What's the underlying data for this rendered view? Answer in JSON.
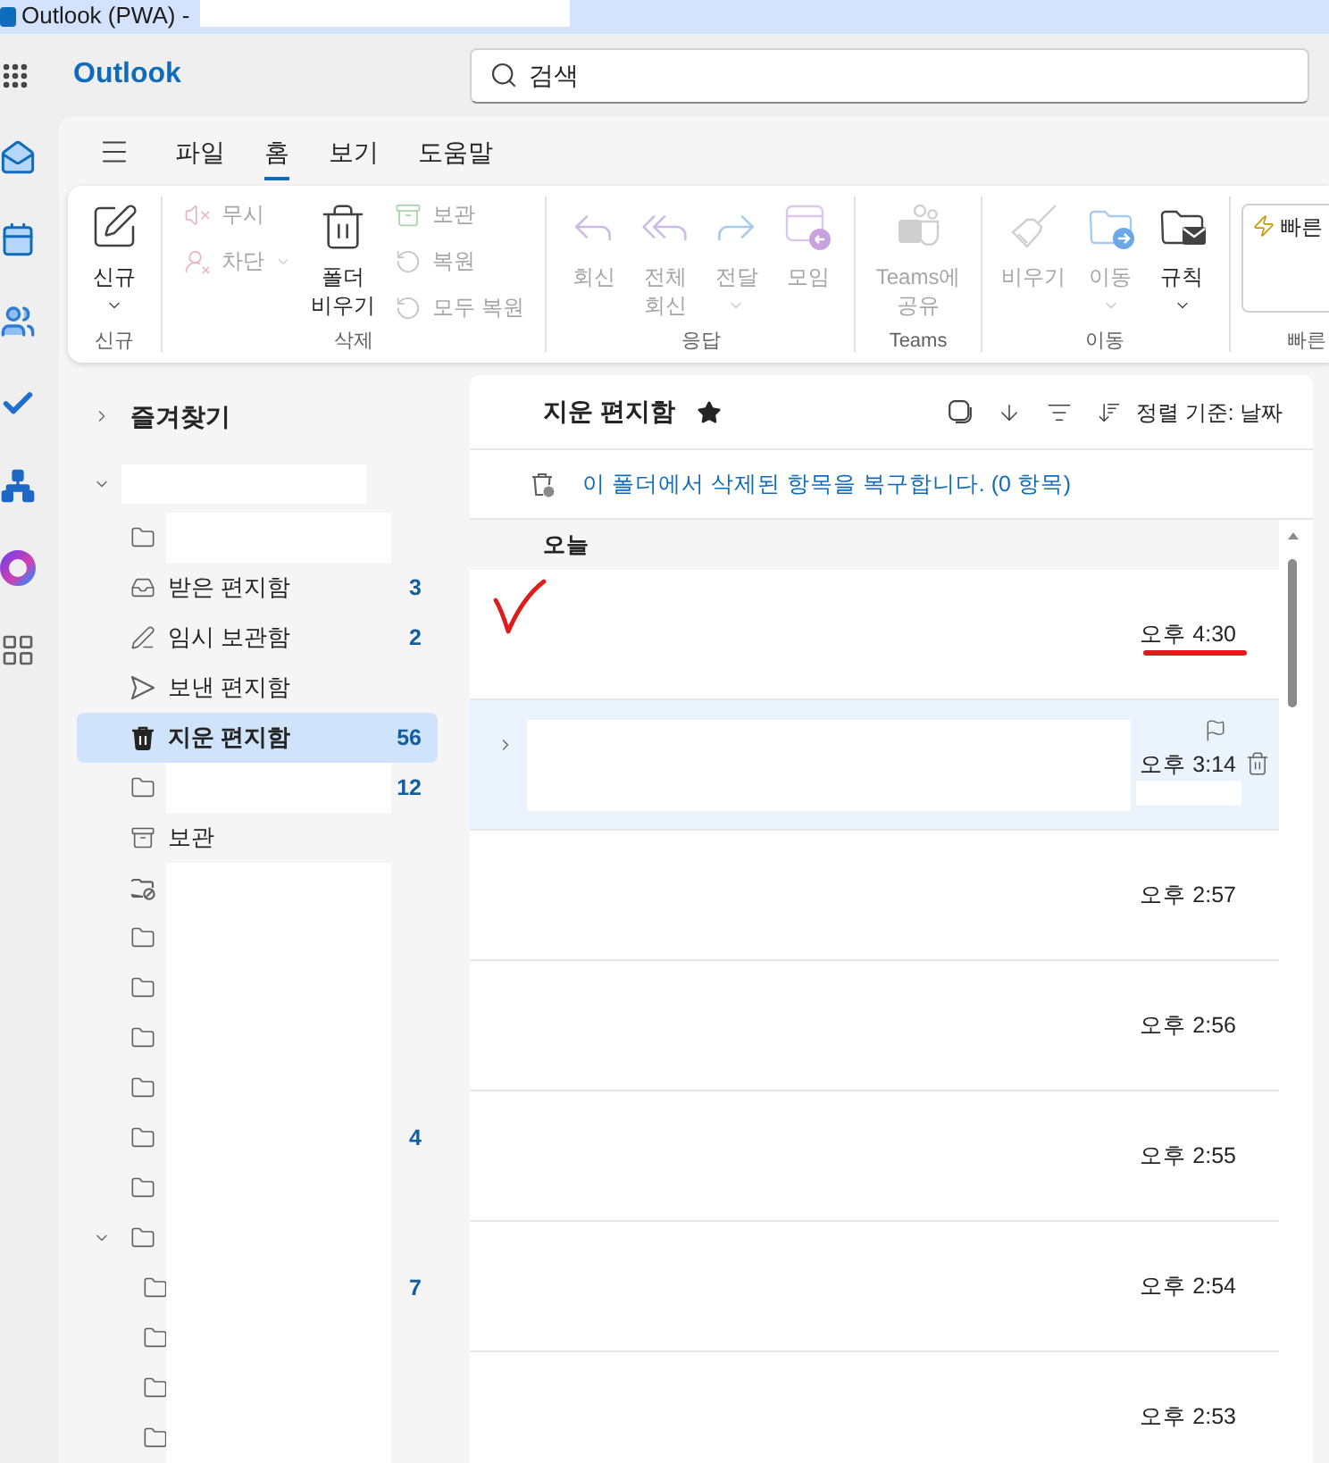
{
  "window": {
    "title": "Outlook (PWA) -"
  },
  "header": {
    "app_name": "Outlook",
    "search": {
      "placeholder": "검색"
    }
  },
  "menu_tabs": [
    {
      "label": "파일",
      "selected": false
    },
    {
      "label": "홈",
      "selected": true
    },
    {
      "label": "보기",
      "selected": false
    },
    {
      "label": "도움말",
      "selected": false
    }
  ],
  "ribbon": {
    "groups": [
      {
        "label": "신규",
        "items": [
          {
            "kind": "new",
            "label": "신규",
            "disabled": false,
            "dropdown": true
          }
        ]
      },
      {
        "label": "삭제",
        "items": [
          {
            "kind": "ignore",
            "label": "무시",
            "disabled": true,
            "dropdown": false
          },
          {
            "kind": "block",
            "label": "차단",
            "disabled": true,
            "dropdown": true
          },
          {
            "kind": "empty_folder",
            "label": "폴더 비우기",
            "disabled": false,
            "dropdown": false
          },
          {
            "kind": "archive",
            "label": "보관",
            "disabled": true,
            "dropdown": false
          },
          {
            "kind": "restore",
            "label": "복원",
            "disabled": true,
            "dropdown": false
          },
          {
            "kind": "restore_all",
            "label": "모두 복원",
            "disabled": true,
            "dropdown": false
          }
        ]
      },
      {
        "label": "응답",
        "items": [
          {
            "kind": "reply",
            "label": "회신",
            "disabled": true,
            "dropdown": false
          },
          {
            "kind": "reply_all",
            "label": "전체 회신",
            "disabled": true,
            "dropdown": false
          },
          {
            "kind": "forward",
            "label": "전달",
            "disabled": true,
            "dropdown": true
          },
          {
            "kind": "meeting",
            "label": "모임",
            "disabled": true,
            "dropdown": false
          }
        ]
      },
      {
        "label": "Teams",
        "items": [
          {
            "kind": "share_teams",
            "label": "Teams에 공유",
            "disabled": true,
            "dropdown": false
          }
        ]
      },
      {
        "label": "이동",
        "items": [
          {
            "kind": "sweep",
            "label": "비우기",
            "disabled": true,
            "dropdown": false
          },
          {
            "kind": "move",
            "label": "이동",
            "disabled": true,
            "dropdown": true
          },
          {
            "kind": "rules",
            "label": "규칙",
            "disabled": false,
            "dropdown": true
          }
        ]
      },
      {
        "label": "빠른",
        "items": [
          {
            "kind": "quick_steps",
            "label": "빠른",
            "disabled": false,
            "dropdown": false
          }
        ]
      }
    ]
  },
  "folder_pane": {
    "favorites": {
      "label": "즐겨찾기",
      "expanded": false
    },
    "account": {
      "expanded": true,
      "folders": [
        {
          "kind": "folder",
          "selected": false
        },
        {
          "kind": "inbox",
          "label": "받은 편지함",
          "count": "3",
          "selected": false
        },
        {
          "kind": "drafts",
          "label": "임시 보관함",
          "count": "2",
          "selected": false
        },
        {
          "kind": "sent",
          "label": "보낸 편지함",
          "selected": false
        },
        {
          "kind": "deleted",
          "label": "지운 편지함",
          "count": "56",
          "selected": true
        },
        {
          "kind": "folder",
          "count": "12",
          "selected": false
        },
        {
          "kind": "archive",
          "label": "보관",
          "selected": false
        },
        {
          "kind": "blocked",
          "selected": false
        },
        {
          "kind": "folder",
          "selected": false
        },
        {
          "kind": "folder",
          "selected": false
        },
        {
          "kind": "folder",
          "selected": false
        },
        {
          "kind": "folder",
          "selected": false
        },
        {
          "kind": "folder",
          "count": "4",
          "selected": false
        },
        {
          "kind": "folder",
          "selected": false
        },
        {
          "kind": "folder",
          "selected": false,
          "expanded": true,
          "children": [
            {
              "kind": "folder",
              "count": "7",
              "selected": false
            },
            {
              "kind": "folder",
              "selected": false
            },
            {
              "kind": "folder",
              "selected": false
            },
            {
              "kind": "folder",
              "selected": false
            }
          ]
        }
      ]
    }
  },
  "message_list": {
    "title": "지운 편지함",
    "favorite": true,
    "sort_label": "정렬 기준: 날짜",
    "restore_link": "이 폴더에서 삭제된 항목을 복구합니다. (0 항목)",
    "groups": [
      {
        "label": "오늘",
        "messages": [
          {
            "time": "오후 4:30",
            "selected": false,
            "expandable": false,
            "redacted": false,
            "marked": true
          },
          {
            "time": "오후 3:14",
            "selected": true,
            "expandable": true,
            "redacted": true,
            "marked": false
          },
          {
            "time": "오후 2:57",
            "selected": false,
            "expandable": false,
            "redacted": false,
            "marked": false
          },
          {
            "time": "오후 2:56",
            "selected": false,
            "expandable": false,
            "redacted": false,
            "marked": false
          },
          {
            "time": "오후 2:55",
            "selected": false,
            "expandable": false,
            "redacted": false,
            "marked": false
          },
          {
            "time": "오후 2:54",
            "selected": false,
            "expandable": false,
            "redacted": false,
            "marked": false
          },
          {
            "time": "오후 2:53",
            "selected": false,
            "expandable": false,
            "redacted": false,
            "marked": false
          }
        ]
      }
    ]
  }
}
